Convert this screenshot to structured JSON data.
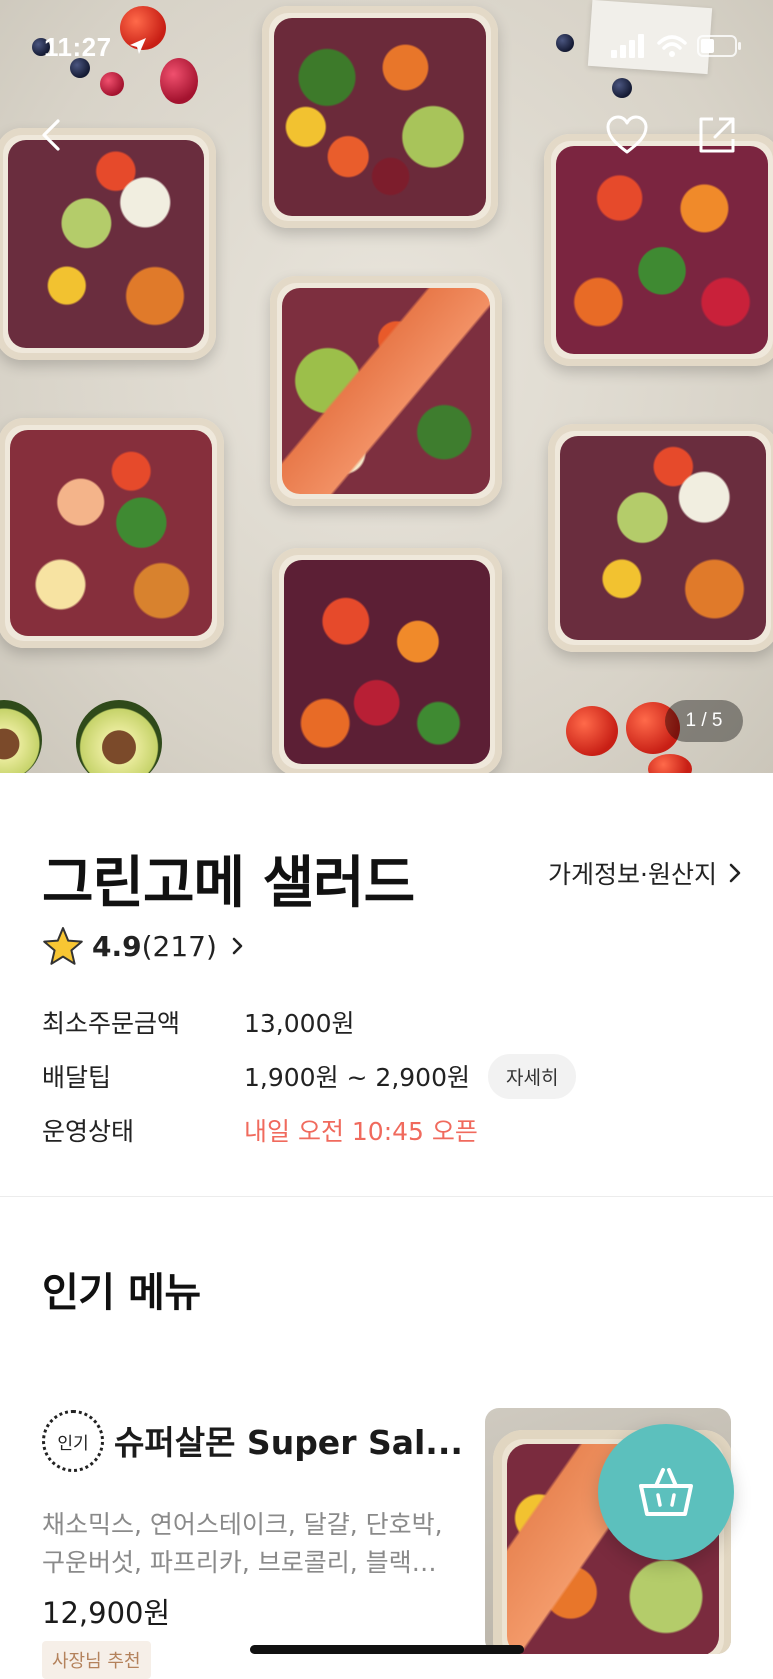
{
  "status_bar": {
    "time": "11:27"
  },
  "hero": {
    "page_indicator": "1 / 5"
  },
  "store": {
    "name": "그린고메 샐러드",
    "info_link": "가게정보·원산지",
    "rating": "4.9",
    "review_count": "(217)",
    "details": [
      {
        "label": "최소주문금액",
        "value": "13,000원"
      },
      {
        "label": "배달팁",
        "value": "1,900원 ~ 2,900원",
        "chip": "자세히"
      },
      {
        "label": "운영상태",
        "value": "내일 오전 10:45 오픈"
      }
    ]
  },
  "popular_menu": {
    "title": "인기 메뉴",
    "items": [
      {
        "badge": "인기",
        "name": "슈퍼살몬 Super Sal...",
        "description": "채소믹스, 연어스테이크, 달걀, 단호박, 구운버섯, 파프리카, 브로콜리, 블랙…",
        "price": "12,900원",
        "tag": "사장님 추천"
      }
    ]
  },
  "colors": {
    "accent": "#5cc0bd",
    "open_status": "#f06a5d",
    "owner_tag": "#b4825c"
  }
}
